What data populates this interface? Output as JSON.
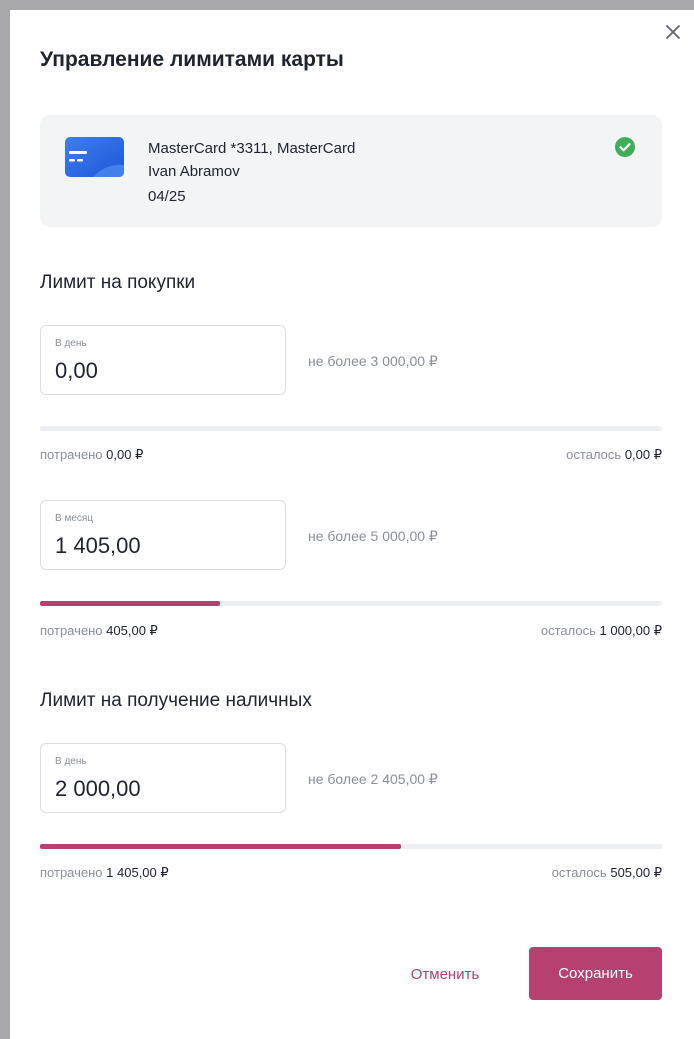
{
  "colors": {
    "accent": "#b64170",
    "success": "#3fae5a",
    "card": "#2a68e0"
  },
  "dialog": {
    "title": "Управление лимитами карты"
  },
  "card": {
    "name": "MasterCard *3311, MasterCard",
    "holder": "Ivan Abramov",
    "expiry": "04/25",
    "icon": "credit-card-icon",
    "status_icon": "check-circle-icon"
  },
  "purchases": {
    "title": "Лимит на покупки",
    "daily": {
      "label": "В день",
      "value": "0,00",
      "hint": "не более 3 000,00 ₽",
      "spent_label": "потрачено",
      "spent": "0,00 ₽",
      "left_label": "осталось",
      "left": "0,00 ₽",
      "progress": 0
    },
    "monthly": {
      "label": "В месяц",
      "value": "1 405,00",
      "hint": "не более 5 000,00 ₽",
      "spent_label": "потрачено",
      "spent": "405,00 ₽",
      "left_label": "осталось",
      "left": "1 000,00 ₽",
      "progress": 0.29
    }
  },
  "cash": {
    "title": "Лимит на получение наличных",
    "daily": {
      "label": "В день",
      "value": "2 000,00",
      "hint": "не более 2 405,00 ₽",
      "spent_label": "потрачено",
      "spent": "1 405,00 ₽",
      "left_label": "осталось",
      "left": "505,00 ₽",
      "progress": 0.58
    }
  },
  "actions": {
    "cancel": "Отменить",
    "save": "Сохранить"
  }
}
